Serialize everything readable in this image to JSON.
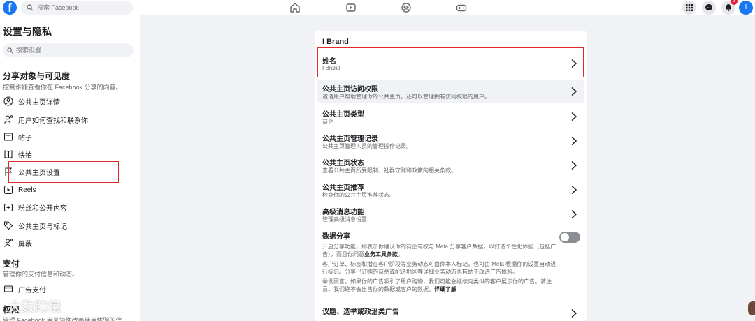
{
  "topbar": {
    "logo": "f",
    "search_placeholder": "搜索 Facebook",
    "notification_count": "2",
    "profile_initial": "I",
    "icons": [
      "home-icon",
      "video-icon",
      "groups-icon",
      "gaming-icon",
      "menu-grid-icon",
      "messenger-icon",
      "bell-icon"
    ]
  },
  "sidebar": {
    "title": "设置与隐私",
    "search_placeholder": "搜索设置",
    "sections": [
      {
        "title": "分享对象与可见度",
        "desc": "控制谁能查看你在 Facebook 分享的内容。",
        "items": [
          {
            "label": "公共主页详情",
            "icon": "user-circle-icon"
          },
          {
            "label": "用户如何查找和联系你",
            "icon": "user-search-icon"
          },
          {
            "label": "帖子",
            "icon": "post-icon"
          },
          {
            "label": "快拍",
            "icon": "book-icon"
          },
          {
            "label": "公共主页设置",
            "icon": "flag-icon"
          },
          {
            "label": "Reels",
            "icon": "reels-icon"
          },
          {
            "label": "粉丝和公开内容",
            "icon": "add-follower-icon"
          },
          {
            "label": "公共主页与标记",
            "icon": "tag-icon"
          },
          {
            "label": "屏蔽",
            "icon": "block-user-icon"
          }
        ]
      },
      {
        "title": "支付",
        "desc": "管理你的支付信息和动态。",
        "items": [
          {
            "label": "广告支付",
            "icon": "card-icon"
          }
        ]
      },
      {
        "title": "权限",
        "desc": "管理 Facebook 用来为你改善使用体验的信"
      }
    ]
  },
  "card": {
    "title": "I Brand",
    "rows": [
      {
        "title": "姓名",
        "sub": "I Brand"
      },
      {
        "title": "公共主页访问权限",
        "sub": "邀请用户帮助管理你的公共主页，还可以管理拥有访问权限的用户。"
      },
      {
        "title": "公共主页类型",
        "sub": "商企"
      },
      {
        "title": "公共主页管理记录",
        "sub": "公共主页管理人员的管理操作记录。"
      },
      {
        "title": "公共主页状态",
        "sub": "查看公共主页所受限制、社群守则和政策的相关条款。"
      },
      {
        "title": "公共主页推荐",
        "sub": "检查你的公共主页推荐状态。"
      },
      {
        "title": "高级消息功能",
        "sub": "管理高级消息设置"
      }
    ],
    "share": {
      "title": "数据分享",
      "p1_a": "开启分享功能，即表示你确认你的商企有权与 Meta 分享客户数据，以打造个性化体验（包括广告），而且你同意",
      "p1_bold": "业务工具条款",
      "p1_end": "。",
      "p2": "客户订单、标签和潜在客户阶段等业务动态可由你本人标记，也可由 Meta 根据你的设置自动进行标记。分享已订购的商品或配送地区等详细业务动态也有助于改进广告体验。",
      "p3_a": "举例而言，如果你的广告吸引了用户购物，我们可能会继续向类似的客户展示你的广告。请注意，我们绝不会出售你的数据或客户的数据。",
      "p3_bold": "详细了解",
      "toggle_on": false
    },
    "last_row": {
      "title": "议题、选举或政治类广告"
    }
  },
  "watermark": "大数跨境"
}
